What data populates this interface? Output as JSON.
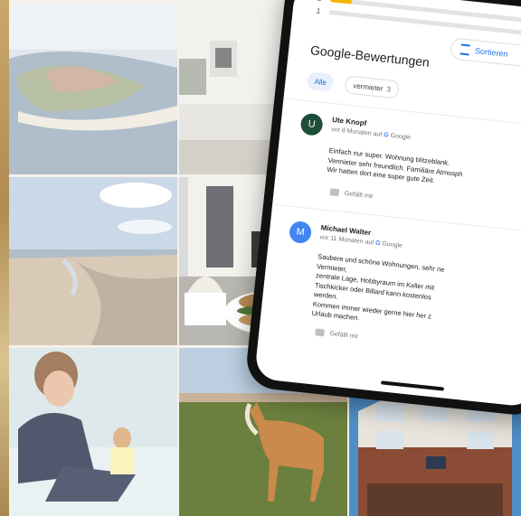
{
  "rating_bars": [
    {
      "label": "2",
      "fill": 0.1
    },
    {
      "label": "1",
      "fill": 0.0
    }
  ],
  "reviews_section": {
    "title": "Google-Bewertungen",
    "sort_label": "Sortieren",
    "filters": [
      {
        "label": "Alle"
      },
      {
        "label": "vermieter",
        "count": "3"
      }
    ]
  },
  "reviews": [
    {
      "initial": "U",
      "avatar_color": "#1e4d3a",
      "name": "Ute Knopf",
      "meta": "vor 8 Monaten auf",
      "source": "Google",
      "lines": [
        "Einfach nur super. Wohnung blitzeblank.",
        "Vermieter sehr freundlich. Familiäre Atmosph",
        "Wir hatten dort eine super gute Zeit."
      ],
      "like_label": "Gefällt mir"
    },
    {
      "initial": "M",
      "avatar_color": "#4285f4",
      "name": "Michael Walter",
      "meta": "vor 11 Monaten auf",
      "source": "Google",
      "lines": [
        "Saubere und schöne Wohnungen, sehr ne",
        "Vermieter,",
        "zentrale Lage, Hobbyraum im Keller mit",
        "Tischkicker oder Billard kann kostenlos",
        "werden.",
        "Kommen immer wieder gerne hier her z",
        "Urlaub machen."
      ],
      "like_label": "Gefällt mir"
    }
  ],
  "colors": {
    "accent": "#1a73e8",
    "star": "#f5b400"
  }
}
